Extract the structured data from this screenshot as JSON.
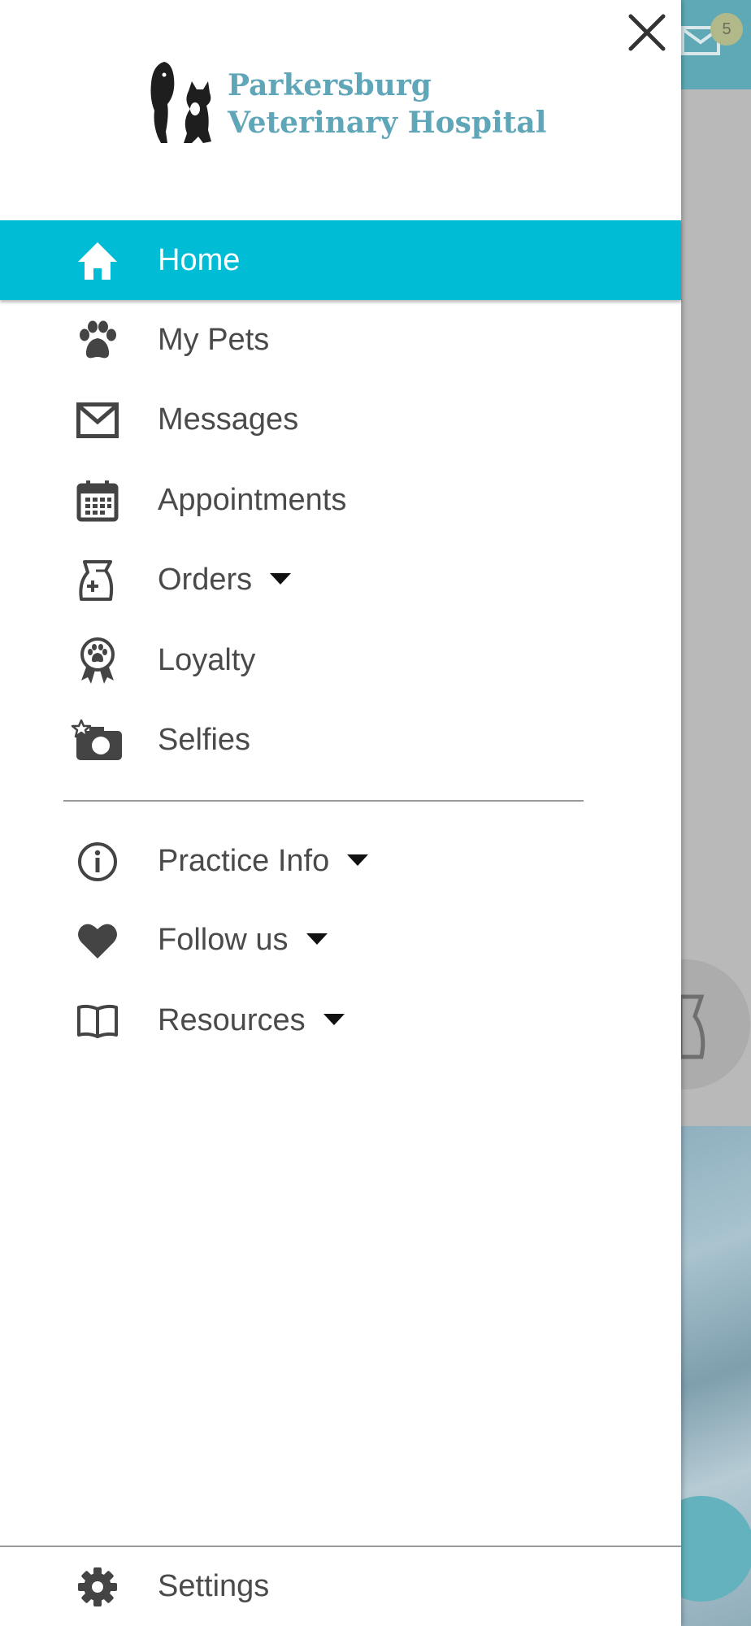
{
  "background": {
    "badge_count": "5",
    "header_color": "#5fa9b6"
  },
  "logo": {
    "line1": "Parkersburg",
    "line2": "Veterinary Hospital",
    "color": "#5fa6b8"
  },
  "menu": {
    "active_color": "#00bcd4",
    "items": [
      {
        "label": "Home",
        "icon": "home-icon",
        "active": true
      },
      {
        "label": "My Pets",
        "icon": "paw-icon"
      },
      {
        "label": "Messages",
        "icon": "envelope-icon"
      },
      {
        "label": "Appointments",
        "icon": "calendar-icon"
      },
      {
        "label": "Orders",
        "icon": "food-bag-icon",
        "has_dropdown": true
      },
      {
        "label": "Loyalty",
        "icon": "award-ribbon-icon"
      },
      {
        "label": "Selfies",
        "icon": "camera-icon"
      }
    ],
    "secondary": [
      {
        "label": "Practice Info",
        "icon": "info-icon",
        "has_dropdown": true
      },
      {
        "label": "Follow us",
        "icon": "heart-icon",
        "has_dropdown": true
      },
      {
        "label": "Resources",
        "icon": "book-icon",
        "has_dropdown": true
      }
    ]
  },
  "footer": {
    "settings_label": "Settings",
    "icon": "gear-icon"
  }
}
